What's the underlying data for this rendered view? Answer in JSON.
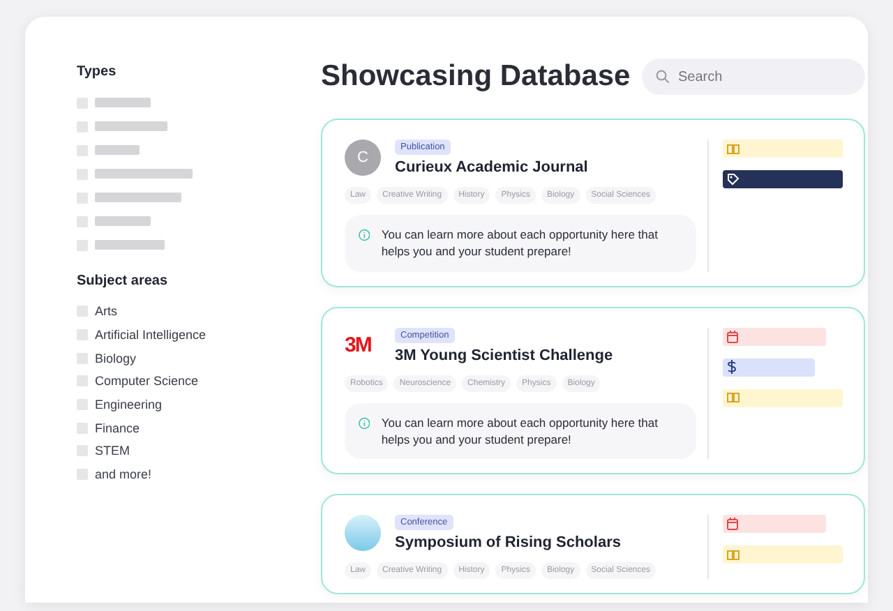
{
  "sidebar": {
    "types_heading": "Types",
    "types": [
      {
        "checked": false
      },
      {
        "checked": false
      },
      {
        "checked": false
      },
      {
        "checked": false
      },
      {
        "checked": false
      },
      {
        "checked": false
      },
      {
        "checked": false
      }
    ],
    "subject_heading": "Subject areas",
    "subjects": [
      {
        "label": "Arts",
        "checked": false
      },
      {
        "label": "Artificial Intelligence",
        "checked": false
      },
      {
        "label": "Biology",
        "checked": false
      },
      {
        "label": "Computer Science",
        "checked": false
      },
      {
        "label": "Engineering",
        "checked": false
      },
      {
        "label": "Finance",
        "checked": false
      },
      {
        "label": "STEM",
        "checked": false
      },
      {
        "label": "and more!",
        "checked": false
      }
    ]
  },
  "header": {
    "title": "Showcasing Database",
    "search": {
      "placeholder": "Search"
    }
  },
  "cards": [
    {
      "logo": {
        "kind": "letter",
        "text": "C"
      },
      "category": "Publication",
      "title": "Curieux Academic Journal",
      "tags": [
        "Law",
        "Creative Writing",
        "History",
        "Physics",
        "Biology",
        "Social Sciences"
      ],
      "note": "You can learn more about each opportunity here that helps you and your student prepare!",
      "chips": [
        {
          "kind": "book"
        },
        {
          "kind": "tag"
        }
      ]
    },
    {
      "logo": {
        "kind": "wordmark",
        "text": "3M"
      },
      "category": "Competition",
      "title": "3M Young Scientist Challenge",
      "tags": [
        "Robotics",
        "Neuroscience",
        "Chemistry",
        "Physics",
        "Biology"
      ],
      "note": "You can learn more about each opportunity here that helps you and your student prepare!",
      "chips": [
        {
          "kind": "calendar"
        },
        {
          "kind": "dollar"
        },
        {
          "kind": "book"
        }
      ]
    },
    {
      "logo": {
        "kind": "image"
      },
      "category": "Conference",
      "title": "Symposium of Rising Scholars",
      "tags": [
        "Law",
        "Creative Writing",
        "History",
        "Physics",
        "Biology",
        "Social Sciences"
      ],
      "chips": [
        {
          "kind": "calendar"
        },
        {
          "kind": "book"
        }
      ]
    }
  ]
}
